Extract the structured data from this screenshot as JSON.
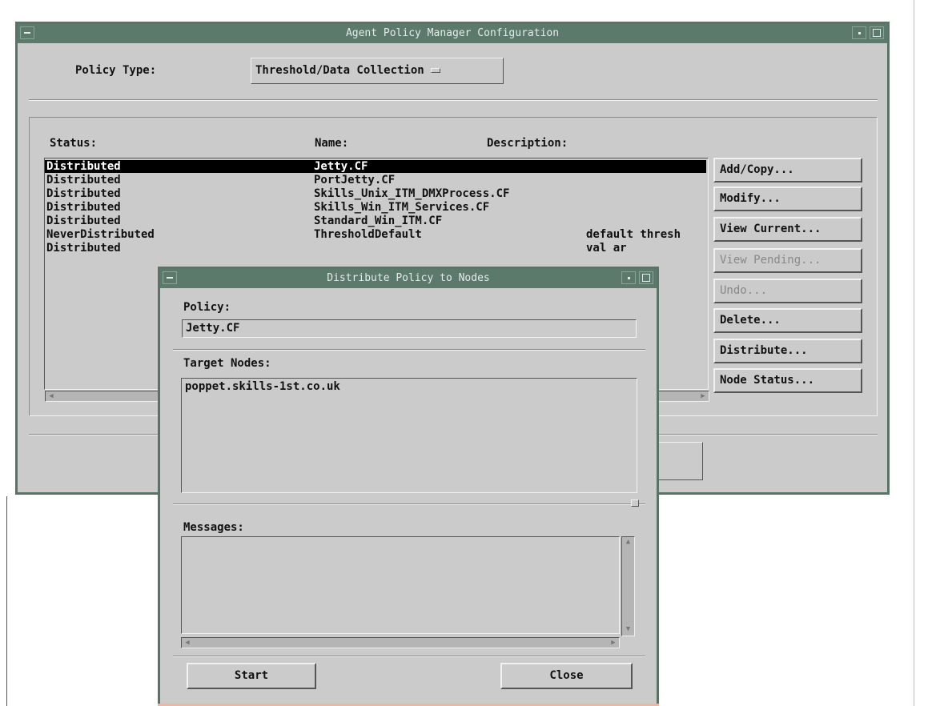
{
  "main_window": {
    "title": "Agent Policy Manager Configuration",
    "policy_type_label": "Policy Type:",
    "policy_type_value": "Threshold/Data Collection",
    "columns": {
      "status": "Status:",
      "name": "Name:",
      "description": "Description:"
    },
    "policies": [
      {
        "status": "Distributed",
        "name": "Jetty.CF",
        "description": "",
        "selected": true
      },
      {
        "status": "Distributed",
        "name": "PortJetty.CF",
        "description": ""
      },
      {
        "status": "Distributed",
        "name": "Skills_Unix_ITM_DMXProcess.CF",
        "description": ""
      },
      {
        "status": "Distributed",
        "name": "Skills_Win_ITM_Services.CF",
        "description": ""
      },
      {
        "status": "Distributed",
        "name": "Standard_Win_ITM.CF",
        "description": ""
      },
      {
        "status": "NeverDistributed",
        "name": "ThresholdDefault",
        "description": "default thresh"
      },
      {
        "status": "Distributed",
        "name": "",
        "description": "val ar"
      }
    ],
    "buttons": {
      "add_copy": "Add/Copy...",
      "modify": "Modify...",
      "view_current": "View Current...",
      "view_pending": "View Pending...",
      "undo": "Undo...",
      "delete": "Delete...",
      "distribute": "Distribute...",
      "node_status": "Node Status..."
    }
  },
  "dialog": {
    "title": "Distribute Policy to Nodes",
    "policy_label": "Policy:",
    "policy_value": "Jetty.CF",
    "target_nodes_label": "Target Nodes:",
    "target_nodes_value": "poppet.skills-1st.co.uk",
    "messages_label": "Messages:",
    "messages_value": "",
    "start_button": "Start",
    "close_button": "Close"
  },
  "colors": {
    "window_bg": "#cbcbcb",
    "titlebar": "#5b7a6b",
    "selection_bg": "#000000"
  }
}
